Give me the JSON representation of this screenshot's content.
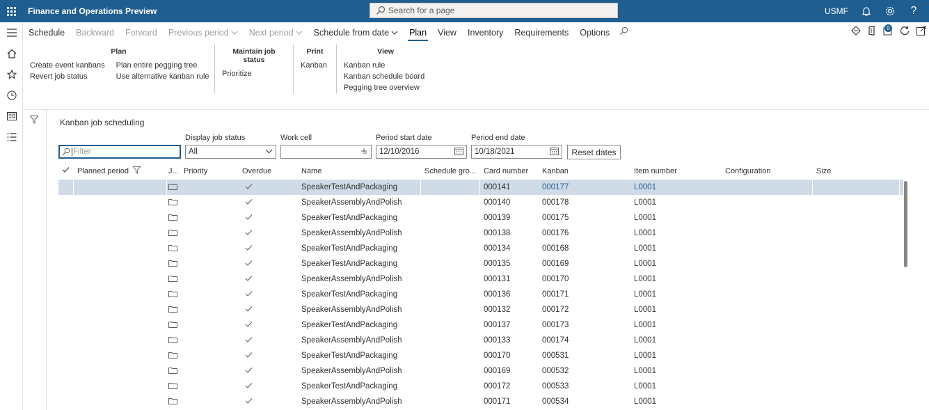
{
  "app": {
    "title": "Finance and Operations Preview",
    "company": "USMF",
    "notification_count": "0"
  },
  "search": {
    "placeholder": "Search for a page"
  },
  "action_tabs": [
    {
      "label": "Schedule",
      "state": "normal"
    },
    {
      "label": "Backward",
      "state": "disabled"
    },
    {
      "label": "Forward",
      "state": "disabled"
    },
    {
      "label": "Previous period",
      "state": "disabled",
      "caret": true
    },
    {
      "label": "Next period",
      "state": "disabled",
      "caret": true
    },
    {
      "label": "Schedule from date",
      "state": "normal",
      "caret": true
    },
    {
      "label": "Plan",
      "state": "active"
    },
    {
      "label": "View",
      "state": "normal"
    },
    {
      "label": "Inventory",
      "state": "normal"
    },
    {
      "label": "Requirements",
      "state": "normal"
    },
    {
      "label": "Options",
      "state": "normal"
    }
  ],
  "groups": {
    "plan": {
      "title": "Plan",
      "col1": [
        "Create event kanbans",
        "Revert job status"
      ],
      "col2": [
        "Plan entire pegging tree",
        "Use alternative kanban rule"
      ]
    },
    "maintain": {
      "title": "Maintain job status",
      "items": [
        "Prioritize"
      ]
    },
    "print": {
      "title": "Print",
      "items": [
        "Kanban"
      ]
    },
    "view": {
      "title": "View",
      "items": [
        "Kanban rule",
        "Kanban schedule board",
        "Pegging tree overview"
      ]
    }
  },
  "page": {
    "title": "Kanban job scheduling",
    "filter_placeholder": "Filter",
    "display_job_status_label": "Display job status",
    "display_job_status_value": "All",
    "work_cell_label": "Work cell",
    "work_cell_value": "",
    "period_start_label": "Period start date",
    "period_start_value": "12/10/2016",
    "period_end_label": "Period end date",
    "period_end_value": "10/18/2021",
    "reset_label": "Reset dates"
  },
  "columns": {
    "planned_period": "Planned period",
    "j": "J...",
    "priority": "Priority",
    "overdue": "Overdue",
    "name": "Name",
    "schedule_group": "Schedule gro...",
    "card_number": "Card number",
    "kanban": "Kanban",
    "item_number": "Item number",
    "configuration": "Configuration",
    "size": "Size"
  },
  "rows": [
    {
      "name": "SpeakerTestAndPackaging",
      "card": "000141",
      "kanban": "000177",
      "item": "L0001",
      "overdue": true
    },
    {
      "name": "SpeakerAssemblyAndPolish",
      "card": "000140",
      "kanban": "000178",
      "item": "L0001",
      "overdue": true
    },
    {
      "name": "SpeakerTestAndPackaging",
      "card": "000139",
      "kanban": "000175",
      "item": "L0001",
      "overdue": true
    },
    {
      "name": "SpeakerAssemblyAndPolish",
      "card": "000138",
      "kanban": "000176",
      "item": "L0001",
      "overdue": true
    },
    {
      "name": "SpeakerTestAndPackaging",
      "card": "000134",
      "kanban": "000168",
      "item": "L0001",
      "overdue": true
    },
    {
      "name": "SpeakerTestAndPackaging",
      "card": "000135",
      "kanban": "000169",
      "item": "L0001",
      "overdue": true
    },
    {
      "name": "SpeakerAssemblyAndPolish",
      "card": "000131",
      "kanban": "000170",
      "item": "L0001",
      "overdue": true
    },
    {
      "name": "SpeakerTestAndPackaging",
      "card": "000136",
      "kanban": "000171",
      "item": "L0001",
      "overdue": true
    },
    {
      "name": "SpeakerAssemblyAndPolish",
      "card": "000132",
      "kanban": "000172",
      "item": "L0001",
      "overdue": true
    },
    {
      "name": "SpeakerTestAndPackaging",
      "card": "000137",
      "kanban": "000173",
      "item": "L0001",
      "overdue": true
    },
    {
      "name": "SpeakerAssemblyAndPolish",
      "card": "000133",
      "kanban": "000174",
      "item": "L0001",
      "overdue": true
    },
    {
      "name": "SpeakerTestAndPackaging",
      "card": "000170",
      "kanban": "000531",
      "item": "L0001",
      "overdue": true
    },
    {
      "name": "SpeakerAssemblyAndPolish",
      "card": "000169",
      "kanban": "000532",
      "item": "L0001",
      "overdue": true
    },
    {
      "name": "SpeakerTestAndPackaging",
      "card": "000172",
      "kanban": "000533",
      "item": "L0001",
      "overdue": true
    },
    {
      "name": "SpeakerAssemblyAndPolish",
      "card": "000171",
      "kanban": "000534",
      "item": "L0001",
      "overdue": true
    }
  ],
  "colors": {
    "brand": "#1f5e91",
    "selected_row": "#cfdbe6",
    "link": "#1f5e91"
  }
}
